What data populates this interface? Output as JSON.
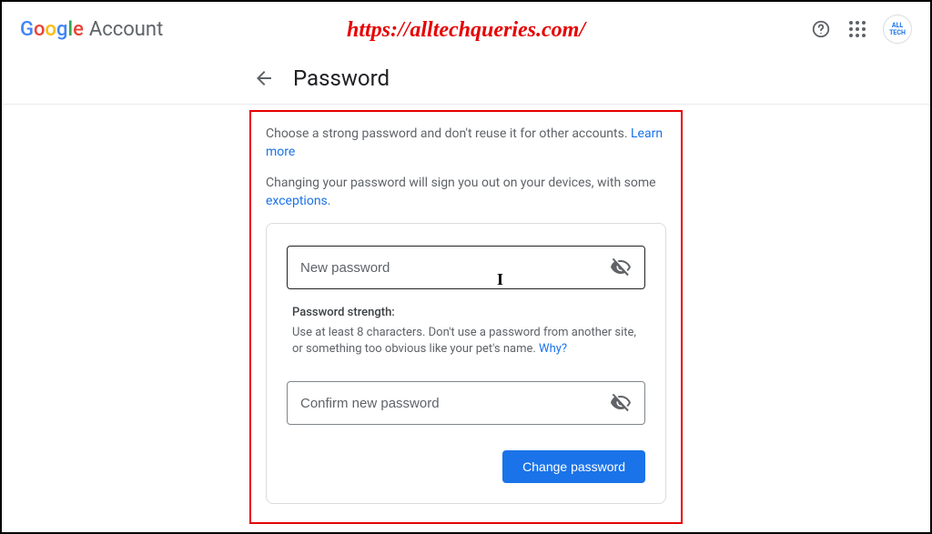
{
  "header": {
    "logo_text": "Google",
    "account_text": "Account",
    "profile_label": "ALL TECH"
  },
  "watermark": "https://alltechqueries.com/",
  "page": {
    "title": "Password"
  },
  "intro": {
    "line1_pre": "Choose a strong password and don't reuse it for other accounts. ",
    "line1_link": "Learn more",
    "line2_pre": "Changing your password will sign you out on your devices, with some ",
    "line2_link": "exceptions",
    "line2_post": "."
  },
  "form": {
    "new_password_placeholder": "New password",
    "new_password_value": "",
    "confirm_password_placeholder": "Confirm new password",
    "confirm_password_value": "",
    "strength_label": "Password strength:",
    "strength_text_pre": "Use at least 8 characters. Don't use a password from another site, or something too obvious like your pet's name. ",
    "strength_link": "Why?",
    "submit_label": "Change password"
  }
}
